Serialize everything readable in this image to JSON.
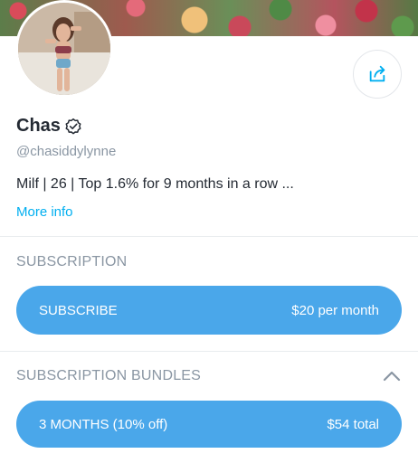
{
  "profile": {
    "display_name": "Chas",
    "handle": "@chasiddylynne",
    "bio": "Milf | 26 | Top 1.6% for 9 months in a row ...",
    "more_info_link": "More info",
    "verified_icon": "verified-badge-icon",
    "share_icon": "share-icon"
  },
  "subscription": {
    "title": "SUBSCRIPTION",
    "button_label": "SUBSCRIBE",
    "button_price": "$20 per month"
  },
  "bundles": {
    "title": "SUBSCRIPTION BUNDLES",
    "collapse_icon": "chevron-up-icon",
    "items": [
      {
        "label": "3 MONTHS (10% off)",
        "price": "$54 total"
      }
    ]
  },
  "colors": {
    "accent": "#00aff0",
    "button_blue": "#4aa7ea",
    "muted_text": "#8a96a3",
    "primary_text": "#242a33"
  }
}
